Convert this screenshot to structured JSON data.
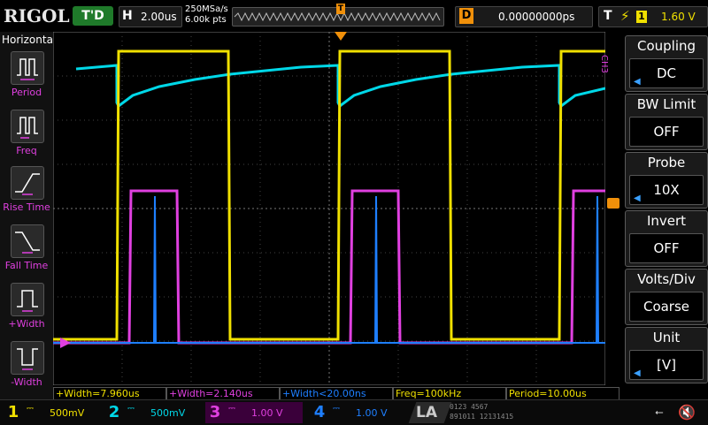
{
  "header": {
    "brand": "RIGOL",
    "run_status": "T'D",
    "timebase_label": "H",
    "timebase_value": "2.00us",
    "sample_rate": "250MSa/s",
    "memory_depth": "6.00k pts",
    "delay_label": "D",
    "delay_value": "0.00000000ps",
    "trigger_label": "T",
    "trigger_source": "1",
    "trigger_level": "1.60 V"
  },
  "left_menu": {
    "title": "Horizontal",
    "items": [
      {
        "label": "Period"
      },
      {
        "label": "Freq"
      },
      {
        "label": "Rise Time"
      },
      {
        "label": "Fall Time"
      },
      {
        "label": "+Width"
      },
      {
        "label": "-Width"
      }
    ]
  },
  "right_menu": {
    "channel_tag": "CH3",
    "items": [
      {
        "label": "Coupling",
        "value": "DC"
      },
      {
        "label": "BW Limit",
        "value": "OFF"
      },
      {
        "label": "Probe",
        "value": "10X"
      },
      {
        "label": "Invert",
        "value": "OFF"
      },
      {
        "label": "Volts/Div",
        "value": "Coarse"
      },
      {
        "label": "Unit",
        "value": "[V]"
      }
    ]
  },
  "measurements": [
    "+Width=7.960us",
    "+Width=2.140us",
    "+Width<20.00ns",
    "Freq=100kHz",
    "Period=10.00us"
  ],
  "channels": [
    {
      "num": "1",
      "scale": "500mV",
      "color": "#f0e000"
    },
    {
      "num": "2",
      "scale": "500mV",
      "color": "#00d8e8"
    },
    {
      "num": "3",
      "scale": "1.00 V",
      "color": "#e040e0"
    },
    {
      "num": "4",
      "scale": "1.00 V",
      "color": "#1e7fff"
    }
  ],
  "bottom": {
    "la_label": "LA",
    "la_digits_row1": "0123 4567",
    "la_digits_row2": "891011 12131415"
  },
  "colors": {
    "ch1": "#f0e000",
    "ch2": "#00d8e8",
    "ch3": "#e040e0",
    "ch4": "#1e7fff",
    "trigger": "#f0900a",
    "status_bg": "#1f7a2a"
  }
}
